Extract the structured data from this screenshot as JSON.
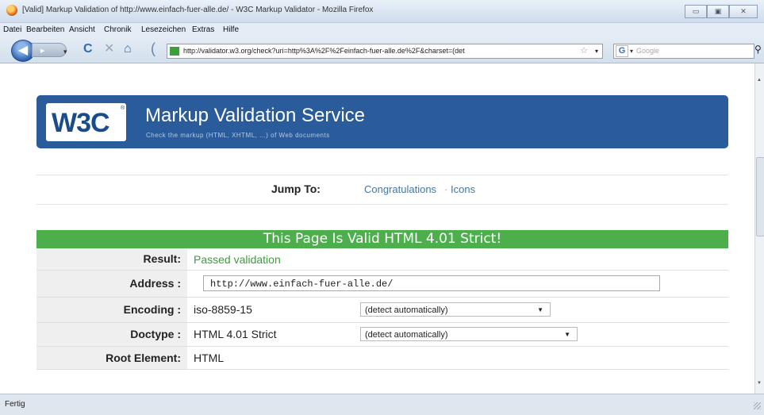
{
  "window": {
    "title": "[Valid] Markup Validation of http://www.einfach-fuer-alle.de/ - W3C Markup Validator - Mozilla Firefox",
    "buttons": [
      "▭",
      "▣",
      "✕"
    ]
  },
  "menu": {
    "items": [
      "Datei",
      "Bearbeiten",
      "Ansicht",
      "Chronik",
      "Lesezeichen",
      "Extras",
      "Hilfe"
    ]
  },
  "nav": {
    "url": "http://validator.w3.org/check?uri=http%3A%2F%2Feinfach-fuer-alle.de%2F&charset=(det",
    "search_placeholder": "Google",
    "search_engine_icon": "G"
  },
  "header": {
    "logo": "W3C",
    "logo_reg": "®",
    "title": "Markup Validation Service",
    "subtitle": "Check the markup (HTML, XHTML, ...) of Web documents"
  },
  "jump": {
    "label": "Jump To:",
    "links": [
      "Congratulations",
      "Icons"
    ],
    "separator": "·"
  },
  "result": {
    "banner": "This Page Is Valid HTML 4.01 Strict!",
    "rows": {
      "result": {
        "label": "Result:",
        "value": "Passed validation"
      },
      "address": {
        "label": "Address :",
        "value": "http://www.einfach-fuer-alle.de/"
      },
      "encoding": {
        "label": "Encoding :",
        "value": "iso-8859-15",
        "select": "(detect automatically)"
      },
      "doctype": {
        "label": "Doctype :",
        "value": "HTML 4.01 Strict",
        "select": "(detect automatically)"
      },
      "root": {
        "label": "Root Element:",
        "value": "HTML"
      }
    }
  },
  "status": {
    "text": "Fertig"
  },
  "colors": {
    "header_blue": "#2a5c9c",
    "valid_green": "#4caf4c",
    "link_blue": "#4477aa",
    "passed_green": "#3a9e3a"
  }
}
